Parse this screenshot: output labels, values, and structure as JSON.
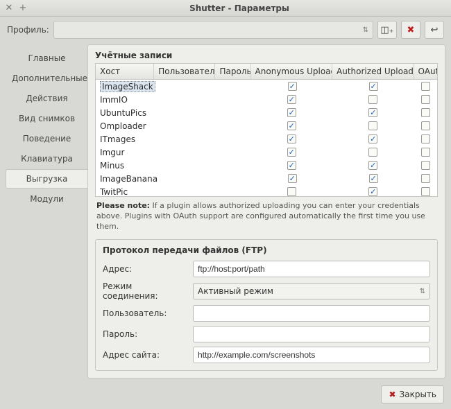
{
  "window": {
    "title": "Shutter - Параметры"
  },
  "toolbar": {
    "profile_label": "Профиль:",
    "icon_save": "save-as-icon",
    "icon_delete": "delete-icon",
    "icon_revert": "revert-icon"
  },
  "tabs": {
    "items": [
      {
        "label": "Главные"
      },
      {
        "label": "Дополнительные"
      },
      {
        "label": "Действия"
      },
      {
        "label": "Вид снимков"
      },
      {
        "label": "Поведение"
      },
      {
        "label": "Клавиатура"
      },
      {
        "label": "Выгрузка"
      },
      {
        "label": "Модули"
      }
    ],
    "active_index": 6
  },
  "accounts": {
    "title": "Учётные записи",
    "columns": [
      "Хост",
      "Пользователь",
      "Пароль",
      "Anonymous Upload",
      "Authorized Upload",
      "OAut"
    ],
    "rows": [
      {
        "host": "ImageShack",
        "anon": true,
        "auth": true,
        "oauth": false,
        "selected": true
      },
      {
        "host": "ImmIO",
        "anon": true,
        "auth": false,
        "oauth": false
      },
      {
        "host": "UbuntuPics",
        "anon": true,
        "auth": true,
        "oauth": false
      },
      {
        "host": "Omploader",
        "anon": true,
        "auth": false,
        "oauth": false
      },
      {
        "host": "ITmages",
        "anon": true,
        "auth": true,
        "oauth": false
      },
      {
        "host": "Imgur",
        "anon": true,
        "auth": false,
        "oauth": false
      },
      {
        "host": "Minus",
        "anon": true,
        "auth": true,
        "oauth": false
      },
      {
        "host": "ImageBanana",
        "anon": true,
        "auth": true,
        "oauth": false
      },
      {
        "host": "TwitPic",
        "anon": false,
        "auth": true,
        "oauth": false
      }
    ]
  },
  "note": {
    "bold": "Please note:",
    "text": " If a plugin allows authorized uploading you can enter your credentials above. Plugins with OAuth support are configured automatically the first time you use them."
  },
  "ftp": {
    "title": "Протокол передачи файлов (FTP)",
    "labels": {
      "uri": "Адрес:",
      "mode": "Режим соединения:",
      "user": "Пользователь:",
      "pass": "Пароль:",
      "site": "Адрес сайта:"
    },
    "values": {
      "uri": "ftp://host:port/path",
      "mode": "Активный режим",
      "user": "",
      "pass": "",
      "site": "http://example.com/screenshots"
    }
  },
  "footer": {
    "close_label": "Закрыть"
  }
}
